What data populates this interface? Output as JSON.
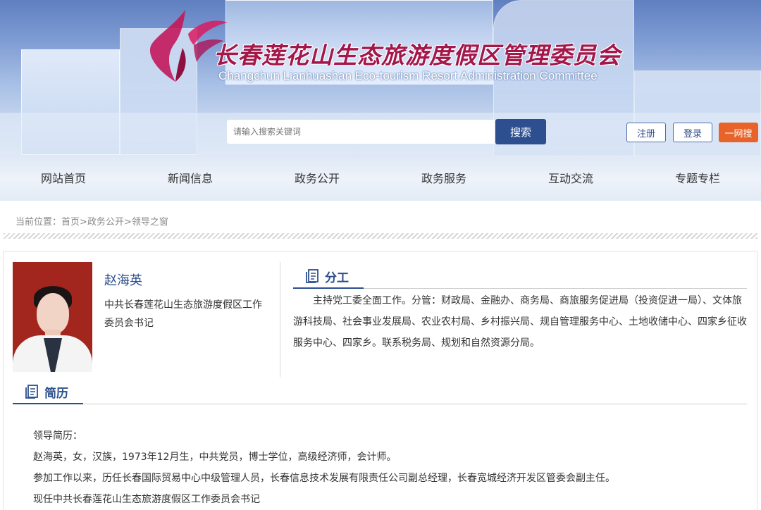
{
  "header": {
    "site_title_cn": "长春莲花山生态旅游度假区管理委员会",
    "site_title_en": "Changchun Lianhuashan Eco-tourism Resort Administration Committee",
    "search_placeholder": "请输入搜索关键词",
    "search_button": "搜索",
    "register_button": "注册",
    "login_button": "登录",
    "one_net_button": "一网搜",
    "brand_color": "#a3174a",
    "accent_color": "#2d4f8f",
    "orange_color": "#e8632a"
  },
  "nav": {
    "items": [
      "网站首页",
      "新闻信息",
      "政务公开",
      "政务服务",
      "互动交流",
      "专题专栏"
    ]
  },
  "breadcrumb": {
    "prefix": "当前位置：",
    "home": "首页",
    "sep1": ">",
    "section": "政务公开",
    "sep2": ">",
    "current": "领导之窗"
  },
  "profile": {
    "name": "赵海英",
    "title": "中共长春莲花山生态旅游度假区工作委员会书记"
  },
  "division": {
    "heading": "分工",
    "text": "主持党工委全面工作。分管：财政局、金融办、商务局、商旅服务促进局（投资促进一局）、文体旅游科技局、社会事业发展局、农业农村局、乡村振兴局、规自管理服务中心、土地收储中心、四家乡征收服务中心、四家乡。联系税务局、规划和自然资源分局。"
  },
  "resume": {
    "heading": "简历",
    "lines": [
      "领导简历：",
      "赵海英，女，汉族，1973年12月生，中共党员，博士学位，高级经济师，会计师。",
      " 参加工作以来，历任长春国际贸易中心中级管理人员，长春信息技术发展有限责任公司副总经理，长春宽城经济开发区管委会副主任。",
      "现任中共长春莲花山生态旅游度假区工作委员会书记"
    ]
  },
  "icons": {
    "logo": "lotus-logo-icon",
    "section": "document-icon"
  }
}
